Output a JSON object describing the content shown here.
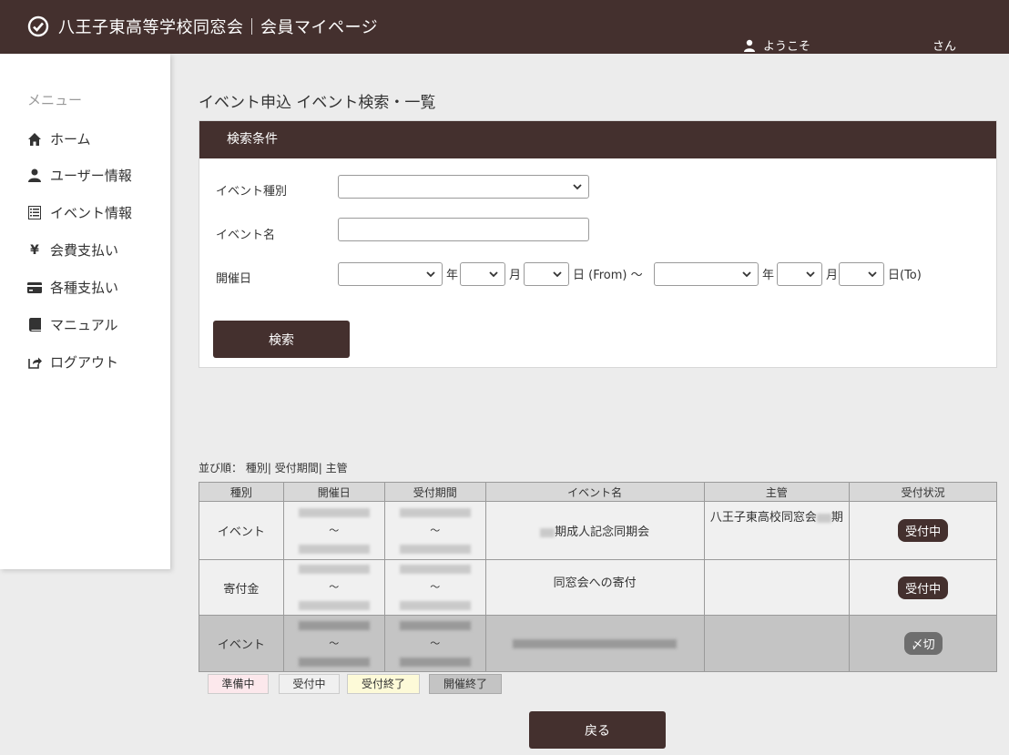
{
  "header": {
    "title": "八王子東高等学校同窓会｜会員マイページ",
    "welcome": "ようこそ",
    "san": "さん"
  },
  "sidebar": {
    "heading": "メニュー",
    "items": [
      {
        "label": "ホーム",
        "icon": "home-icon"
      },
      {
        "label": "ユーザー情報",
        "icon": "user-icon"
      },
      {
        "label": "イベント情報",
        "icon": "list-icon"
      },
      {
        "label": "会費支払い",
        "icon": "yen-icon"
      },
      {
        "label": "各種支払い",
        "icon": "card-icon"
      },
      {
        "label": "マニュアル",
        "icon": "book-icon"
      },
      {
        "label": "ログアウト",
        "icon": "logout-icon"
      }
    ]
  },
  "page": {
    "title": "イベント申込 イベント検索・一覧"
  },
  "search": {
    "heading": "検索条件",
    "event_type_label": "イベント種別",
    "event_name_label": "イベント名",
    "date_label": "開催日",
    "year": "年",
    "month": "月",
    "day_from": "日 (From) ～",
    "day_to": "日(To)",
    "button": "検索"
  },
  "sort": {
    "prefix": "並び順：",
    "type": "種別|",
    "period": "受付期間|",
    "host": "主管"
  },
  "table": {
    "headers": [
      "種別",
      "開催日",
      "受付期間",
      "イベント名",
      "主管",
      "受付状況"
    ],
    "tilde": "～",
    "rows": [
      {
        "type": "イベント",
        "name_suffix": "期成人記念同期会",
        "host_prefix": "八王子東高校同窓会",
        "host_suffix": "期",
        "status": "受付中"
      },
      {
        "type": "寄付金",
        "name": "同窓会への寄付",
        "status": "受付中"
      },
      {
        "type": "イベント",
        "status": "〆切"
      }
    ]
  },
  "legend": {
    "preparing": "準備中",
    "accepting": "受付中",
    "closed": "受付終了",
    "finished": "開催終了"
  },
  "back_button": "戻る",
  "colors": {
    "brand": "#44302e",
    "legend_preparing": "#fce8ec",
    "legend_accepting": "#f0f0f0",
    "legend_closed": "#fdfad8",
    "legend_finished": "#c4c4c4"
  }
}
